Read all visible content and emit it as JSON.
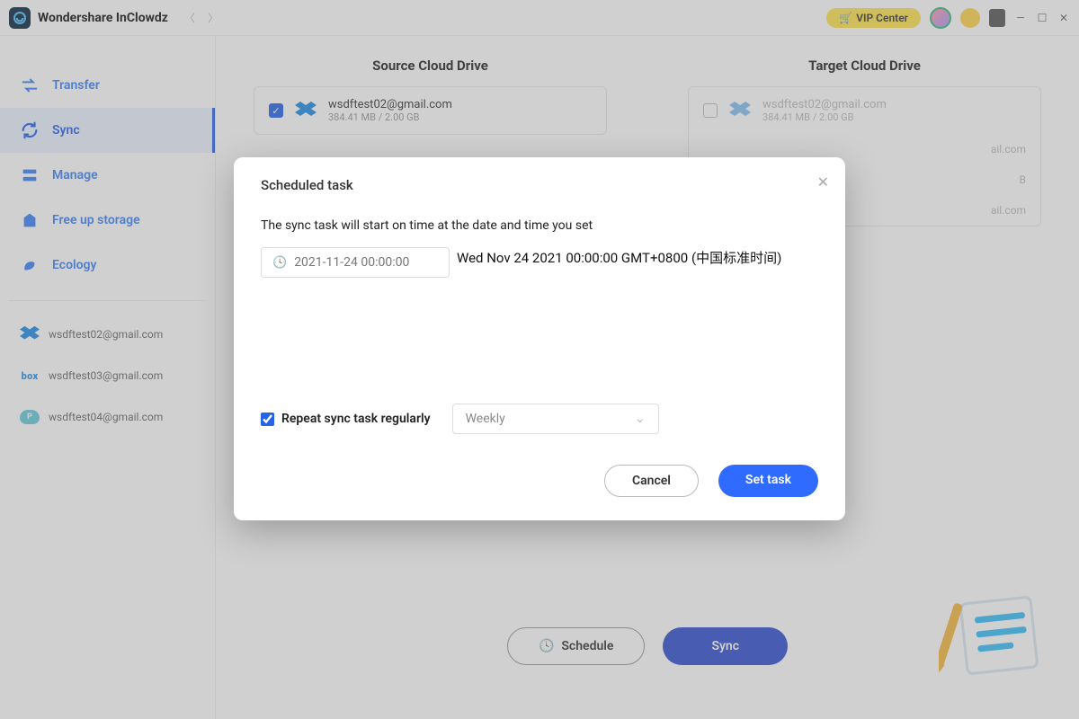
{
  "app": {
    "name": "Wondershare InClowdz",
    "vip_label": "VIP Center"
  },
  "sidebar": {
    "items": [
      {
        "label": "Transfer"
      },
      {
        "label": "Sync"
      },
      {
        "label": "Manage"
      },
      {
        "label": "Free up storage"
      },
      {
        "label": "Ecology"
      }
    ],
    "accounts": [
      {
        "email": "wsdftest02@gmail.com",
        "provider": "dropbox"
      },
      {
        "email": "wsdftest03@gmail.com",
        "provider": "box"
      },
      {
        "email": "wsdftest04@gmail.com",
        "provider": "pcloud"
      }
    ]
  },
  "main": {
    "source_title": "Source Cloud Drive",
    "target_title": "Target Cloud Drive",
    "source_drive": {
      "email": "wsdftest02@gmail.com",
      "size": "384.41 MB / 2.00 GB",
      "checked": true
    },
    "target_drive": {
      "email": "wsdftest02@gmail.com",
      "size": "384.41 MB / 2.00 GB",
      "checked": false
    },
    "target_partial_rows": [
      "ail.com",
      "B",
      "ail.com"
    ],
    "schedule_btn": "Schedule",
    "sync_btn": "Sync"
  },
  "modal": {
    "title": "Scheduled task",
    "desc": "The sync task will start on time at the date and time you set",
    "datetime_value": "2021-11-24 00:00:00",
    "datetime_echo": "Wed Nov 24 2021 00:00:00 GMT+0800 (中国标准时间)",
    "repeat_label": "Repeat sync task regularly",
    "repeat_checked": true,
    "interval": "Weekly",
    "cancel": "Cancel",
    "set": "Set task"
  }
}
